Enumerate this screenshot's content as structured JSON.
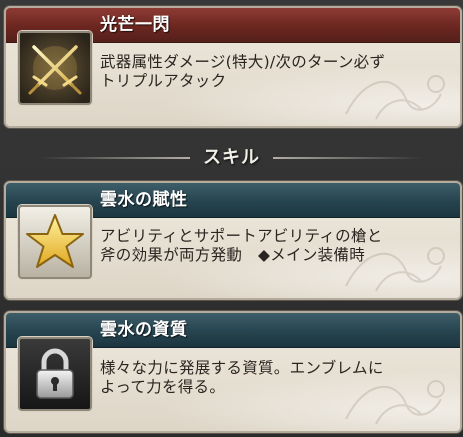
{
  "colors": {
    "header_red": "#6c2620",
    "header_teal": "#26444f",
    "card_body": "#e6dfd2",
    "text_dark": "#2a2520",
    "background": "#2e2e2e"
  },
  "weapon_skill": {
    "name": "光芒一閃",
    "description": "武器属性ダメージ(特大)/次のターン必ず\nトリプルアタック",
    "icon": "crossed-swords-icon"
  },
  "skills_section": {
    "title": "スキル"
  },
  "skills": [
    {
      "name": "雲水の賦性",
      "description": "アビリティとサポートアビリティの槍と\n斧の効果が両方発動　◆メイン装備時",
      "icon": "star-icon"
    },
    {
      "name": "雲水の資質",
      "description": "様々な力に発展する資質。エンブレムに\nよって力を得る。",
      "icon": "padlock-icon"
    }
  ]
}
